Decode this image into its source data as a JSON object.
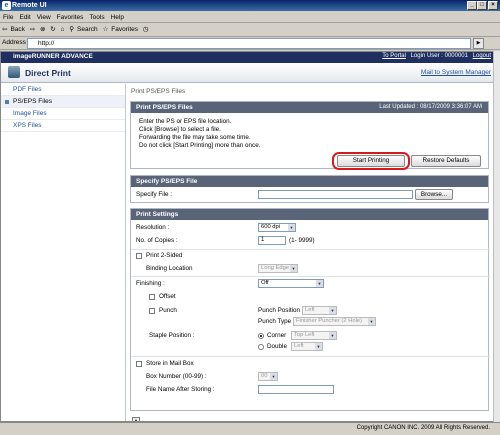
{
  "window": {
    "title": "Remote UI"
  },
  "menu": [
    "File",
    "Edit",
    "View",
    "Favorites",
    "Tools",
    "Help"
  ],
  "toolbar": {
    "back": "Back",
    "search": "Search",
    "favorites": "Favorites"
  },
  "address": {
    "label": "Address",
    "url": "http://",
    "go": "Go"
  },
  "header": {
    "brand": "imageRUNNER ADVANCE",
    "to_portal": "To Portal",
    "login_user": "Login User : 0000001",
    "logout": "Logout"
  },
  "app": {
    "title": "Direct Print",
    "mail_link": "Mail to System Manager"
  },
  "sidebar": {
    "items": [
      {
        "label": "PDF Files"
      },
      {
        "label": "PS/EPS Files"
      },
      {
        "label": "Image Files"
      },
      {
        "label": "XPS Files"
      }
    ]
  },
  "breadcrumb": "Print PS/EPS Files",
  "panel_print": {
    "title": "Print PS/EPS Files",
    "updated": "Last Updated : 08/17/2009 3:36:07 AM",
    "info": [
      "Enter the PS or EPS file location.",
      "Click [Browse] to select a file.",
      "Forwarding the file may take some time.",
      "Do not click [Start Printing] more than once."
    ],
    "start_button": "Start Printing",
    "restore_button": "Restore Defaults"
  },
  "panel_file": {
    "title": "Specify PS/EPS File",
    "label": "Specify File :",
    "value": "",
    "browse": "Browse..."
  },
  "panel_settings": {
    "title": "Print Settings",
    "resolution_label": "Resolution :",
    "resolution_value": "600 dpi",
    "copies_label": "No. of Copies :",
    "copies_value": "1",
    "copies_range": "(1- 9999)",
    "two_sided_label": "Print 2-Sided",
    "binding_label": "Binding Location",
    "binding_value": "Long Edge",
    "finishing_label": "Finishing :",
    "finishing_value": "Off",
    "offset_label": "Offset",
    "punch_label": "Punch",
    "punch_position_label": "Punch Position",
    "punch_position_value": "Left",
    "punch_type_label": "Punch Type",
    "punch_type_value": "Finisher Puncher (2 Hole)",
    "staple_label": "Staple Position :",
    "corner_label": "Corner",
    "corner_value": "Top Left",
    "double_label": "Double",
    "double_value": "Left",
    "mailbox_label": "Store in Mail Box",
    "box_number_label": "Box Number (00-99) :",
    "box_number_value": "00",
    "file_name_label": "File Name After Storing :",
    "file_name_value": ""
  },
  "copyright": "Copyright CANON INC. 2009 All Rights Reserved."
}
